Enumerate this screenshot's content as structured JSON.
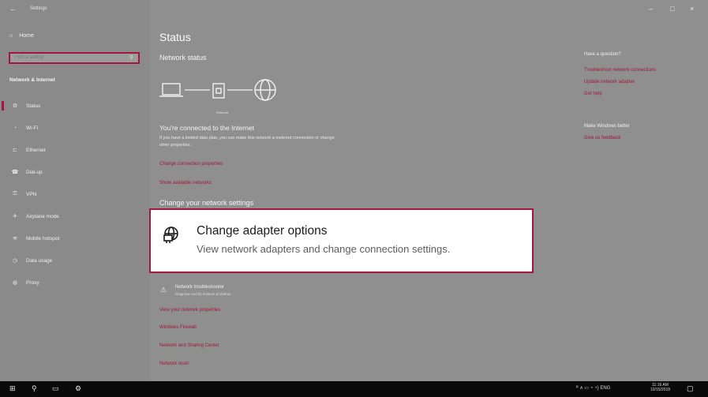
{
  "titlebar": {
    "back": "←",
    "title": "Settings",
    "min": "–",
    "max": "□",
    "close": "×"
  },
  "sidebar": {
    "home": "Home",
    "search_placeholder": "Find a setting",
    "section": "Network & Internet",
    "items": [
      {
        "label": "Status",
        "icon": "⚙"
      },
      {
        "label": "Wi-Fi",
        "icon": "◔"
      },
      {
        "label": "Ethernet",
        "icon": "⊏"
      },
      {
        "label": "Dial-up",
        "icon": "☎"
      },
      {
        "label": "VPN",
        "icon": "⚿"
      },
      {
        "label": "Airplane mode",
        "icon": "✈"
      },
      {
        "label": "Mobile hotspot",
        "icon": "≋"
      },
      {
        "label": "Data usage",
        "icon": "◷"
      },
      {
        "label": "Proxy",
        "icon": "◍"
      }
    ]
  },
  "main": {
    "title": "Status",
    "network_status": "Network status",
    "ethernet_label": "Ethernet",
    "connected_title": "You're connected to the Internet",
    "connected_desc": "If you have a limited data plan, you can make this network a metered connection or change other properties.",
    "link_change_props": "Change connection properties",
    "link_show_networks": "Show available networks",
    "change_settings": "Change your network settings",
    "popup_title": "Change adapter options",
    "popup_sub": "View network adapters and change connection settings.",
    "troubleshooter_title": "Network troubleshooter",
    "troubleshooter_sub": "Diagnose and fix network problems.",
    "links_bottom": [
      "View your network properties",
      "Windows Firewall",
      "Network and Sharing Center",
      "Network reset"
    ]
  },
  "right": {
    "question": "Have a question?",
    "q_links": [
      "Troubleshoot network connections",
      "Update network adapter",
      "Get help"
    ],
    "better": "Make Windows better",
    "feedback": "Give us feedback"
  },
  "taskbar": {
    "tray": "ᴿ ∧ ▭ ◔ ◔) ENG",
    "time": "11:16 AM",
    "date": "10/15/2018"
  },
  "colors": {
    "accent": "#a3163d"
  }
}
